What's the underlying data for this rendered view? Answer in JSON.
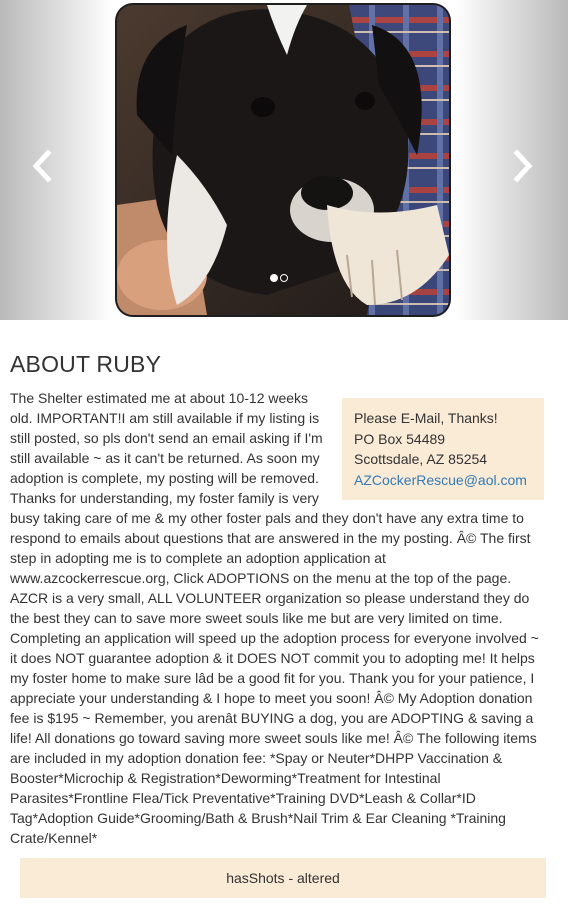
{
  "carousel": {
    "prev_icon": "chevron-left-icon",
    "next_icon": "chevron-right-icon",
    "slide_count": 2,
    "active_slide": 1
  },
  "pet": {
    "title": "ABOUT RUBY",
    "description": "The Shelter estimated me at about 10-12 weeks old. IMPORTANT!I am still available if my listing is still posted, so pls don't send an email asking if I'm still available ~ as it can't be returned. As soon my adoption is complete, my posting will be removed. Thanks for understanding, my foster family is very busy taking care of me & my other foster pals and they don't have any extra time to respond to emails about questions that are answered in the my posting. Â© The first step in adopting me is to complete an adoption application at www.azcockerrescue.org, Click ADOPTIONS on the menu at the top of the page. AZCR is a very small, ALL VOLUNTEER organization so please understand they do the best they can to save more sweet souls like me but are very limited on time. Completing an application will speed up the adoption process for everyone involved ~ it does NOT guarantee adoption & it DOES NOT commit you to adopting me! It helps my foster home to make sure lâd be a good fit for you. Thank you for your patience, I appreciate your understanding & I hope to meet you soon! Â© My Adoption donation fee is $195 ~ Remember, you arenât BUYING a dog, you are ADOPTING & saving a life! All donations go toward saving more sweet souls like me! Â© The following items are included in my adoption donation fee: *Spay or Neuter*DHPP Vaccination & Booster*Microchip & Registration*Deworming*Treatment for Intestinal Parasites*Frontline Flea/Tick Preventative*Training DVD*Leash & Collar*ID Tag*Adoption Guide*Grooming/Bath & Brush*Nail Trim & Ear Cleaning *Training Crate/Kennel*",
    "attributes": "hasShots - altered"
  },
  "contact": {
    "note": "Please E-Mail, Thanks!",
    "address_line1": "PO Box 54489",
    "address_line2": "Scottsdale, AZ 85254",
    "email": "AZCockerRescue@aol.com"
  },
  "colors": {
    "info_box_bg": "#faebd7",
    "link": "#337ab7",
    "text": "#333333"
  }
}
